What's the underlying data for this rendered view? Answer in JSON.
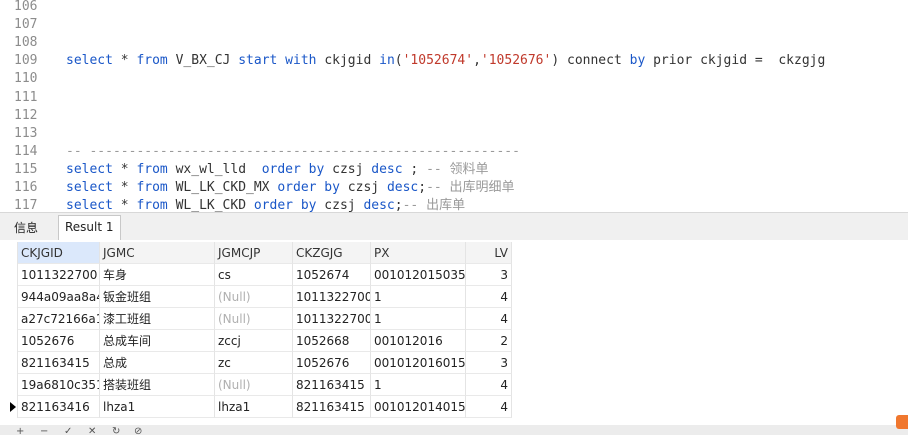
{
  "editor": {
    "lines": [
      {
        "num": "106"
      },
      {
        "num": "107"
      },
      {
        "num": "108"
      },
      {
        "num": "109",
        "tokens": [
          {
            "t": "kw",
            "v": "select"
          },
          {
            "t": "plain",
            "v": " * "
          },
          {
            "t": "kw",
            "v": "from"
          },
          {
            "t": "plain",
            "v": " V_BX_CJ "
          },
          {
            "t": "kw",
            "v": "start with"
          },
          {
            "t": "plain",
            "v": " ckjgid "
          },
          {
            "t": "kw",
            "v": "in"
          },
          {
            "t": "plain",
            "v": "("
          },
          {
            "t": "str",
            "v": "'1052674'"
          },
          {
            "t": "plain",
            "v": ","
          },
          {
            "t": "str",
            "v": "'1052676'"
          },
          {
            "t": "plain",
            "v": ") connect "
          },
          {
            "t": "kw",
            "v": "by"
          },
          {
            "t": "plain",
            "v": " prior ckjgid =  ckzgjg"
          }
        ]
      },
      {
        "num": "110"
      },
      {
        "num": "111"
      },
      {
        "num": "112"
      },
      {
        "num": "113"
      },
      {
        "num": "114",
        "tokens": [
          {
            "t": "cm",
            "v": "-- -------------------------------------------------------"
          }
        ]
      },
      {
        "num": "115",
        "tokens": [
          {
            "t": "kw",
            "v": "select"
          },
          {
            "t": "plain",
            "v": " * "
          },
          {
            "t": "kw",
            "v": "from"
          },
          {
            "t": "plain",
            "v": " wx_wl_lld  "
          },
          {
            "t": "kw",
            "v": "order by"
          },
          {
            "t": "plain",
            "v": " czsj "
          },
          {
            "t": "kw",
            "v": "desc"
          },
          {
            "t": "plain",
            "v": " ; "
          },
          {
            "t": "cm",
            "v": "-- 领料单"
          }
        ]
      },
      {
        "num": "116",
        "tokens": [
          {
            "t": "kw",
            "v": "select"
          },
          {
            "t": "plain",
            "v": " * "
          },
          {
            "t": "kw",
            "v": "from"
          },
          {
            "t": "plain",
            "v": " WL_LK_CKD_MX "
          },
          {
            "t": "kw",
            "v": "order by"
          },
          {
            "t": "plain",
            "v": " czsj "
          },
          {
            "t": "kw",
            "v": "desc"
          },
          {
            "t": "plain",
            "v": ";"
          },
          {
            "t": "cm",
            "v": "-- 出库明细单"
          }
        ]
      },
      {
        "num": "117",
        "tokens": [
          {
            "t": "kw",
            "v": "select"
          },
          {
            "t": "plain",
            "v": " * "
          },
          {
            "t": "kw",
            "v": "from"
          },
          {
            "t": "plain",
            "v": " WL_LK_CKD "
          },
          {
            "t": "kw",
            "v": "order by"
          },
          {
            "t": "plain",
            "v": " czsj "
          },
          {
            "t": "kw",
            "v": "desc"
          },
          {
            "t": "plain",
            "v": ";"
          },
          {
            "t": "cm",
            "v": "-- 出库单"
          }
        ]
      }
    ]
  },
  "tabs": {
    "info": "信息",
    "result": "Result 1"
  },
  "grid": {
    "columns": [
      "CKJGID",
      "JGMC",
      "JGMCJP",
      "CKZGJG",
      "PX",
      "LV"
    ],
    "rows": [
      [
        "1011322700",
        "车身",
        "cs",
        "1052674",
        "001012015035",
        "3"
      ],
      [
        "944a09aa8a4",
        "钣金班组",
        "(Null)",
        "1011322700",
        "1",
        "4"
      ],
      [
        "a27c72166a1",
        "漆工班组",
        "(Null)",
        "1011322700",
        "1",
        "4"
      ],
      [
        "1052676",
        "总成车间",
        "zccj",
        "1052668",
        "001012016",
        "2"
      ],
      [
        "821163415",
        "总成",
        "zc",
        "1052676",
        "001012016015",
        "3"
      ],
      [
        "19a6810c351",
        "搭装班组",
        "(Null)",
        "821163415",
        "1",
        "4"
      ],
      [
        "821163416",
        "lhza1",
        "lhza1",
        "821163415",
        "0010120140150",
        "4"
      ]
    ],
    "current_row": 6
  },
  "colors": {
    "keyword": "#1a57c8",
    "string": "#c0392b",
    "comment": "#9a9a9a",
    "accent_badge": "#f0772e"
  }
}
